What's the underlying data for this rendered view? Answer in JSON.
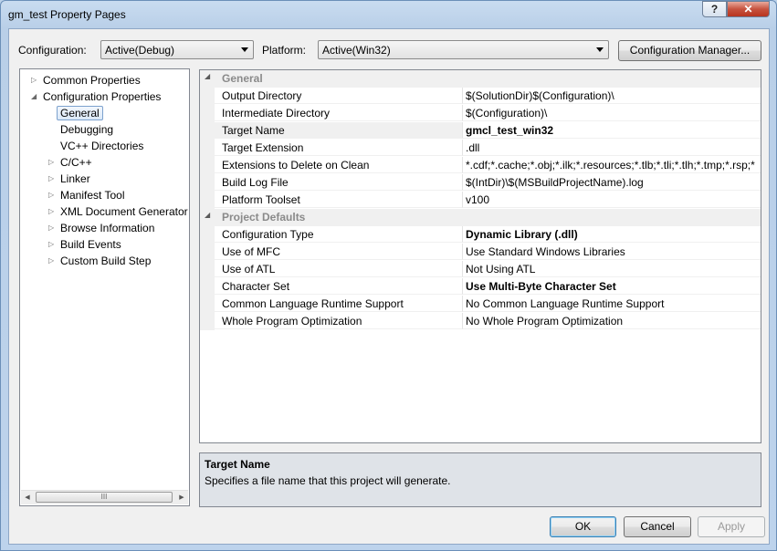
{
  "window": {
    "title": "gm_test Property Pages",
    "help_glyph": "?",
    "close_glyph": "✕"
  },
  "config_bar": {
    "configuration_label": "Configuration:",
    "configuration_value": "Active(Debug)",
    "platform_label": "Platform:",
    "platform_value": "Active(Win32)",
    "manager_button": "Configuration Manager..."
  },
  "tree": {
    "items": [
      {
        "label": "Common Properties",
        "twisty": "▷"
      },
      {
        "label": "Configuration Properties",
        "twisty": "◢"
      },
      {
        "label": "General",
        "twisty": ""
      },
      {
        "label": "Debugging",
        "twisty": ""
      },
      {
        "label": "VC++ Directories",
        "twisty": ""
      },
      {
        "label": "C/C++",
        "twisty": "▷"
      },
      {
        "label": "Linker",
        "twisty": "▷"
      },
      {
        "label": "Manifest Tool",
        "twisty": "▷"
      },
      {
        "label": "XML Document Generator",
        "twisty": "▷"
      },
      {
        "label": "Browse Information",
        "twisty": "▷"
      },
      {
        "label": "Build Events",
        "twisty": "▷"
      },
      {
        "label": "Custom Build Step",
        "twisty": "▷"
      }
    ],
    "selected": "General",
    "scroll_left": "◀",
    "scroll_right": "▶",
    "scroll_grip": "III"
  },
  "grid": {
    "sections": [
      {
        "title": "General",
        "rows": [
          {
            "name": "Output Directory",
            "value": "$(SolutionDir)$(Configuration)\\",
            "bold": false
          },
          {
            "name": "Intermediate Directory",
            "value": "$(Configuration)\\",
            "bold": false
          },
          {
            "name": "Target Name",
            "value": "gmcl_test_win32",
            "bold": true
          },
          {
            "name": "Target Extension",
            "value": ".dll",
            "bold": false
          },
          {
            "name": "Extensions to Delete on Clean",
            "value": "*.cdf;*.cache;*.obj;*.ilk;*.resources;*.tlb;*.tli;*.tlh;*.tmp;*.rsp;*",
            "bold": false
          },
          {
            "name": "Build Log File",
            "value": "$(IntDir)\\$(MSBuildProjectName).log",
            "bold": false
          },
          {
            "name": "Platform Toolset",
            "value": "v100",
            "bold": false
          }
        ]
      },
      {
        "title": "Project Defaults",
        "rows": [
          {
            "name": "Configuration Type",
            "value": "Dynamic Library (.dll)",
            "bold": true
          },
          {
            "name": "Use of MFC",
            "value": "Use Standard Windows Libraries",
            "bold": false
          },
          {
            "name": "Use of ATL",
            "value": "Not Using ATL",
            "bold": false
          },
          {
            "name": "Character Set",
            "value": "Use Multi-Byte Character Set",
            "bold": true
          },
          {
            "name": "Common Language Runtime Support",
            "value": "No Common Language Runtime Support",
            "bold": false
          },
          {
            "name": "Whole Program Optimization",
            "value": "No Whole Program Optimization",
            "bold": false
          }
        ]
      }
    ],
    "collapse_glyph": "◢"
  },
  "description": {
    "title": "Target Name",
    "text": "Specifies a file name that this project will generate."
  },
  "buttons": {
    "ok": "OK",
    "cancel": "Cancel",
    "apply": "Apply"
  }
}
